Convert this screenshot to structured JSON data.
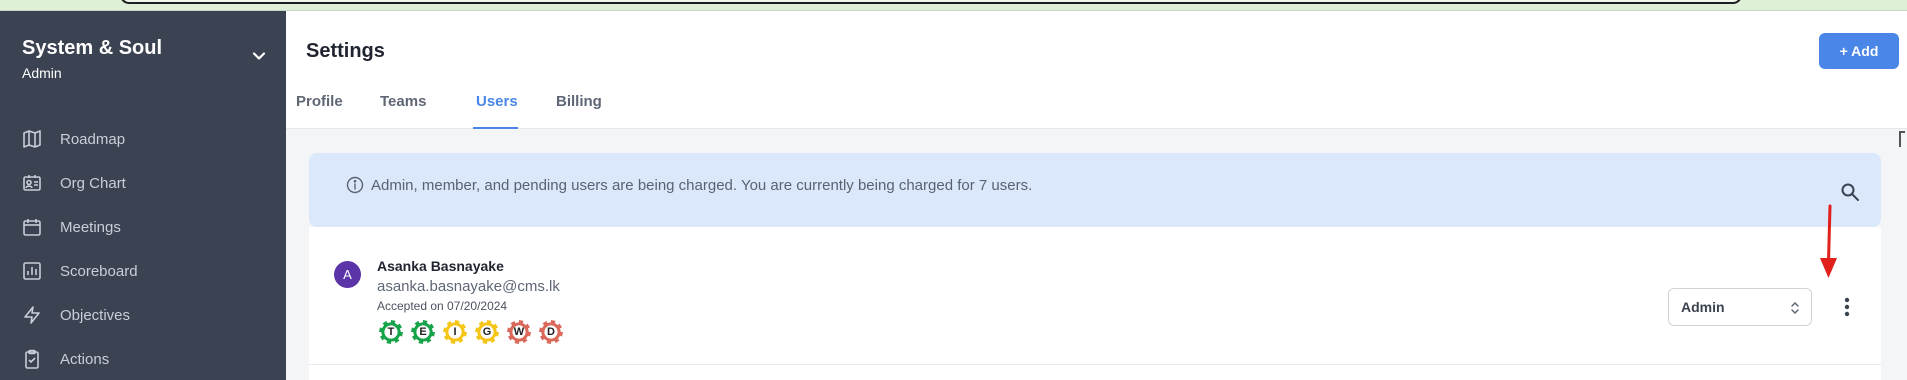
{
  "sidebar": {
    "org_name": "System & Soul",
    "org_role": "Admin",
    "items": [
      {
        "label": "Roadmap",
        "icon": "map-icon"
      },
      {
        "label": "Org Chart",
        "icon": "id-card-icon"
      },
      {
        "label": "Meetings",
        "icon": "calendar-icon"
      },
      {
        "label": "Scoreboard",
        "icon": "bar-chart-icon"
      },
      {
        "label": "Objectives",
        "icon": "lightning-icon"
      },
      {
        "label": "Actions",
        "icon": "clipboard-check-icon"
      }
    ]
  },
  "header": {
    "title": "Settings",
    "add_label": "+ Add",
    "tabs": [
      {
        "label": "Profile"
      },
      {
        "label": "Teams"
      },
      {
        "label": "Users"
      },
      {
        "label": "Billing"
      }
    ],
    "active_tab": "Users"
  },
  "banner": {
    "text": "Admin, member, and pending users are being charged. You are currently being charged for 7 users."
  },
  "user": {
    "initial": "A",
    "name": "Asanka Basnayake",
    "email": "asanka.basnayake@cms.lk",
    "accepted": "Accepted on 07/20/2024",
    "badges": [
      {
        "letter": "T",
        "color": "#16a34a"
      },
      {
        "letter": "E",
        "color": "#16a34a"
      },
      {
        "letter": "I",
        "color": "#f5c518"
      },
      {
        "letter": "G",
        "color": "#f5c518"
      },
      {
        "letter": "W",
        "color": "#d9695a"
      },
      {
        "letter": "D",
        "color": "#d9695a"
      }
    ],
    "role": "Admin"
  },
  "colors": {
    "sidebar_bg": "#3b4252",
    "accent": "#4a86e8",
    "banner_bg": "#dbe8fc",
    "avatar_bg": "#5b35a8",
    "annotation_arrow": "#e0211b"
  }
}
